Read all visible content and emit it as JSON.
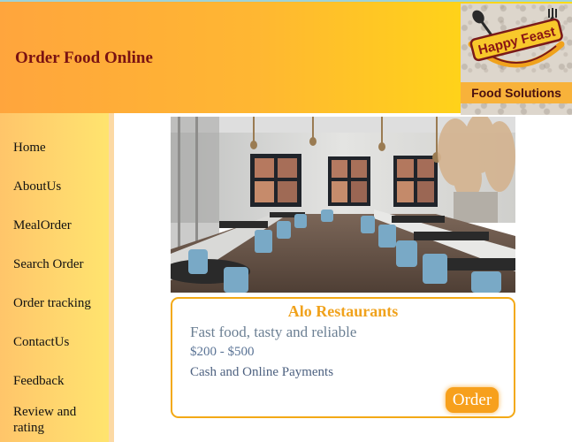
{
  "header": {
    "title": "Order Food Online",
    "logo": {
      "brand": "Happy Feast",
      "tagline": "Food Solutions"
    }
  },
  "sidebar": {
    "items": [
      {
        "label": "Home"
      },
      {
        "label": "AboutUs"
      },
      {
        "label": "MealOrder"
      },
      {
        "label": "Search Order"
      },
      {
        "label": "Order tracking"
      },
      {
        "label": "ContactUs"
      },
      {
        "label": "Feedback"
      },
      {
        "label": "Review and rating"
      }
    ]
  },
  "restaurant": {
    "name": "Alo Restaurants",
    "description": "Fast food, tasty and reliable",
    "price_range": "$200 - $500",
    "payment": "Cash and Online Payments",
    "order_label": "Order"
  },
  "colors": {
    "header_start": "#ffa53d",
    "header_end": "#ffdc17",
    "title": "#7a1212",
    "accent": "#f3a916"
  }
}
